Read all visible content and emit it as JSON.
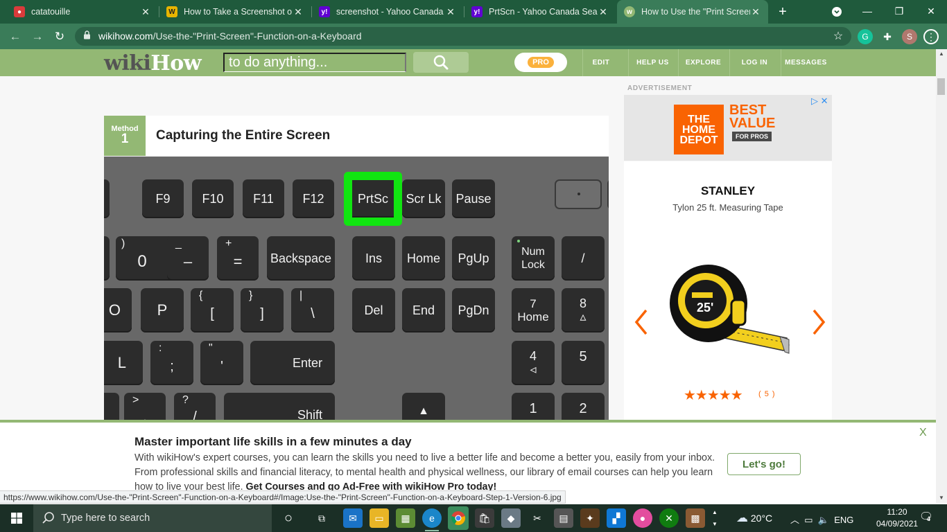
{
  "browser": {
    "tabs": [
      {
        "title": "catatouille",
        "icon": "c-icon",
        "color": "#d93b3b",
        "active": false
      },
      {
        "title": "How to Take a Screenshot on",
        "icon": "w-icon",
        "color": "#e8b400",
        "active": false
      },
      {
        "title": "screenshot - Yahoo Canada S",
        "icon": "yahoo-icon",
        "color": "#6001d2",
        "active": false
      },
      {
        "title": "PrtScn - Yahoo Canada Searc",
        "icon": "yahoo-icon",
        "color": "#6001d2",
        "active": false
      },
      {
        "title": "How to Use the \"Print Screen",
        "icon": "wh-icon",
        "color": "#93b874",
        "active": true
      }
    ],
    "url_host": "wikihow.com",
    "url_path": "/Use-the-\"Print-Screen\"-Function-on-a-Keyboard",
    "profile_initial": "S"
  },
  "wikihow": {
    "logo_wiki": "wiki",
    "logo_how": "How",
    "search_placeholder": "to do anything...",
    "pro_label": "PRO",
    "nav": [
      "EDIT",
      "HELP US",
      "EXPLORE",
      "LOG IN",
      "MESSAGES"
    ]
  },
  "article": {
    "method_label": "Method",
    "method_number": "1",
    "method_title": "Capturing the Entire Screen"
  },
  "keyboard": {
    "row1": [
      "F9",
      "F10",
      "F11",
      "F12",
      "PrtSc",
      "Scr Lk",
      "Pause"
    ],
    "highlighted": "PrtSc",
    "row2": [
      {
        "shift": ")",
        "main": "0"
      },
      {
        "shift": "_",
        "main": "–"
      },
      {
        "shift": "+",
        "main": "="
      },
      {
        "shift": "",
        "main": "Backspace"
      },
      {
        "shift": "",
        "main": "Ins"
      },
      {
        "shift": "",
        "main": "Home"
      },
      {
        "shift": "",
        "main": "PgUp"
      },
      {
        "shift": "",
        "main": "Num\nLock"
      },
      {
        "shift": "",
        "main": "/"
      }
    ],
    "row3": [
      {
        "shift": "",
        "main": "O"
      },
      {
        "shift": "",
        "main": "P"
      },
      {
        "shift": "{",
        "main": "["
      },
      {
        "shift": "}",
        "main": "]"
      },
      {
        "shift": "|",
        "main": "\\"
      },
      {
        "shift": "",
        "main": "Del"
      },
      {
        "shift": "",
        "main": "End"
      },
      {
        "shift": "",
        "main": "PgDn"
      },
      {
        "shift": "",
        "main": "7\nHome"
      },
      {
        "shift": "",
        "main": "8\n▵"
      }
    ],
    "row4": [
      {
        "shift": "",
        "main": "L"
      },
      {
        "shift": ":",
        "main": ";"
      },
      {
        "shift": "\"",
        "main": "'"
      },
      {
        "shift": "",
        "main": "Enter"
      },
      {
        "shift": "",
        "main": "4\n◃"
      },
      {
        "shift": "",
        "main": "5"
      }
    ],
    "row5": [
      {
        "shift": ">",
        "main": "."
      },
      {
        "shift": "?",
        "main": "/"
      },
      {
        "shift": "",
        "main": "Shift"
      },
      {
        "shift": "",
        "main": "▲"
      },
      {
        "shift": "",
        "main": "1"
      },
      {
        "shift": "",
        "main": "2"
      }
    ]
  },
  "ad": {
    "label": "ADVERTISEMENT",
    "banner_brand": "THE HOME DEPOT",
    "banner_headline": "BEST VALUE",
    "banner_sub": "FOR PROS",
    "brand": "STANLEY",
    "product": "Tylon 25 ft. Measuring Tape",
    "rating": 5,
    "rating_count": "( 5 )"
  },
  "banner": {
    "title": "Master important life skills in a few minutes a day",
    "text": "With wikiHow's expert courses, you can learn the skills you need to live a better life and become a better you, easily from your inbox. From professional skills and financial literacy, to mental health and physical wellness, our library of email courses can help you learn how to live your best life.",
    "cta_bold": "Get Courses and go Ad-Free with wikiHow Pro today!",
    "button": "Let's go!",
    "close": "X"
  },
  "status_url": "https://www.wikihow.com/Use-the-\"Print-Screen\"-Function-on-a-Keyboard#/Image:Use-the-\"Print-Screen\"-Function-on-a-Keyboard-Step-1-Version-6.jpg",
  "taskbar": {
    "search_placeholder": "Type here to search",
    "weather": "20°C",
    "language": "ENG",
    "time": "11:20",
    "date": "04/09/2021",
    "notifications": "4"
  }
}
